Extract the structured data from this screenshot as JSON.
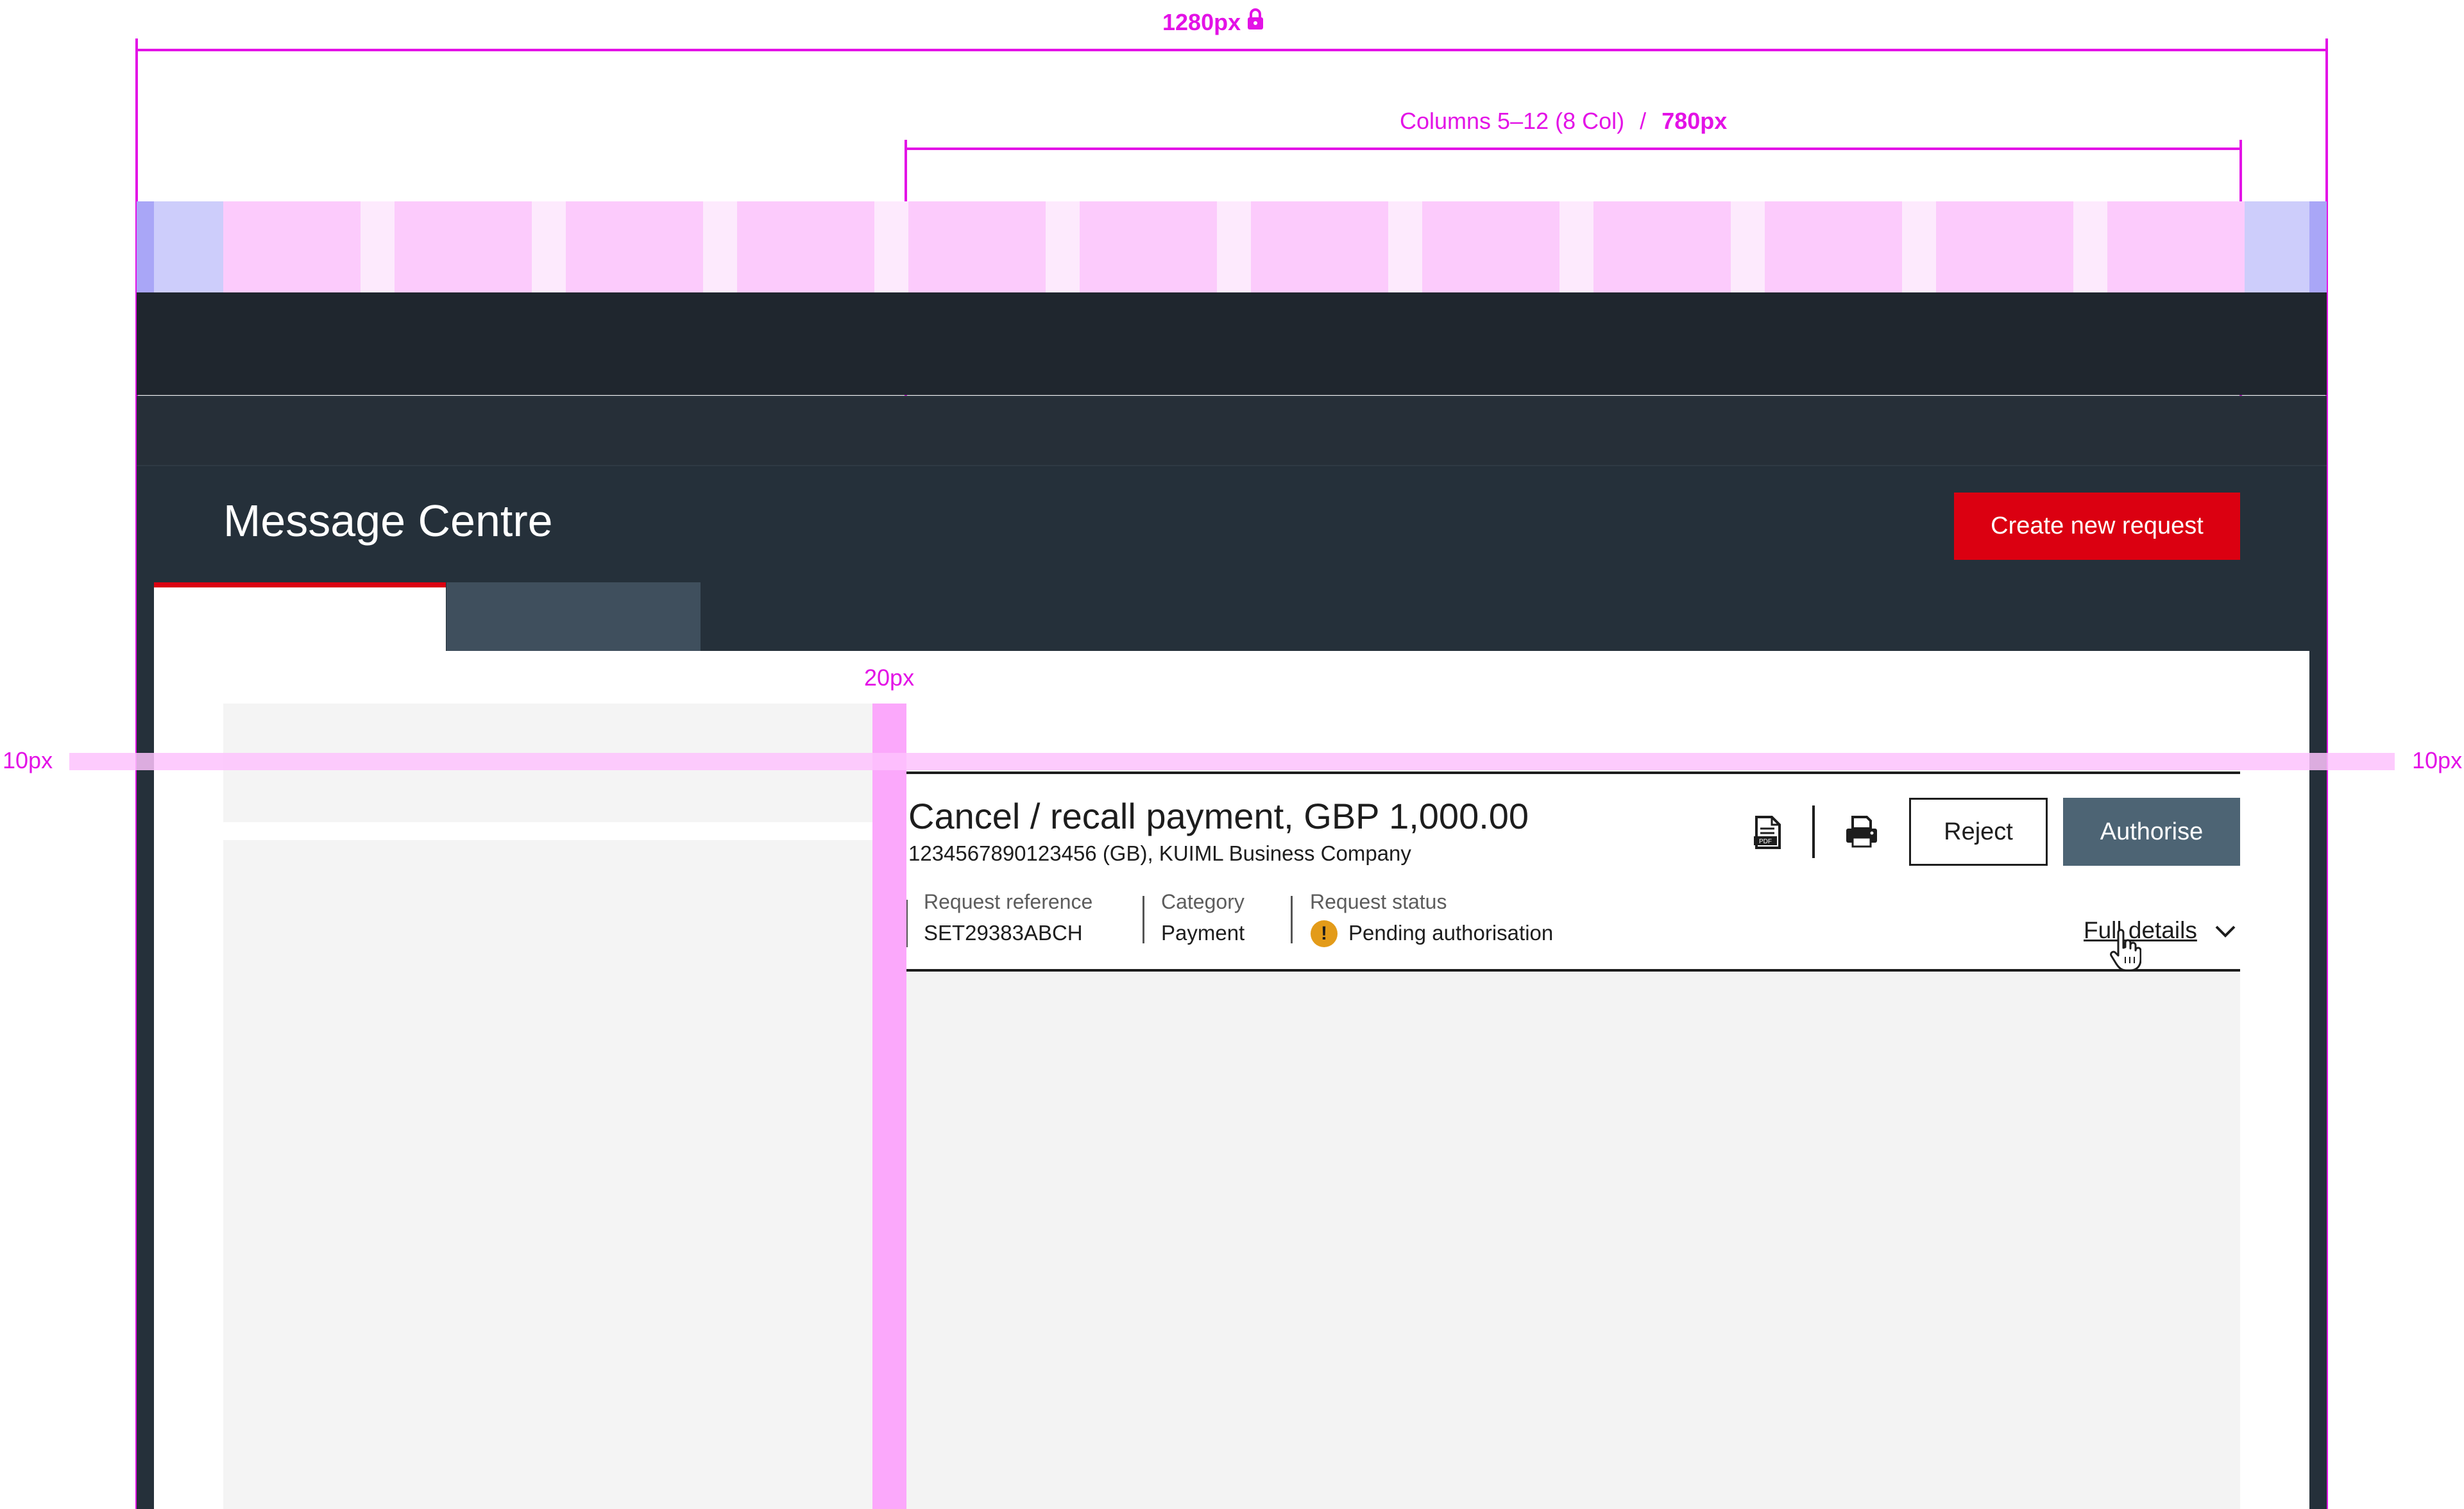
{
  "annotations": {
    "total_width_label": "1280px",
    "columns_label": "Columns 5–12 (8 Col)",
    "columns_sep": "/",
    "columns_width_label": "780px",
    "gutter_label": "20px",
    "margin_left_label": "10px",
    "margin_right_label": "10px",
    "color": "#e312e6"
  },
  "header": {
    "title": "Message Centre",
    "create_button_label": "Create new request",
    "accent_color": "#db0011"
  },
  "detail": {
    "title": "Cancel / recall payment, GBP 1,000.00",
    "subtitle": "1234567890123456 (GB), KUIML Business Company",
    "meta": [
      {
        "label": "Request reference",
        "value": "SET29383ABCH"
      },
      {
        "label": "Category",
        "value": "Payment"
      },
      {
        "label": "Request status",
        "value": "Pending authorisation"
      }
    ],
    "status_icon_glyph": "!",
    "reject_label": "Reject",
    "authorise_label": "Authorise",
    "full_details_label": "Full details",
    "icons": [
      "pdf-icon",
      "print-icon",
      "chevron-down-icon",
      "lock-icon",
      "hand-cursor-icon"
    ]
  }
}
